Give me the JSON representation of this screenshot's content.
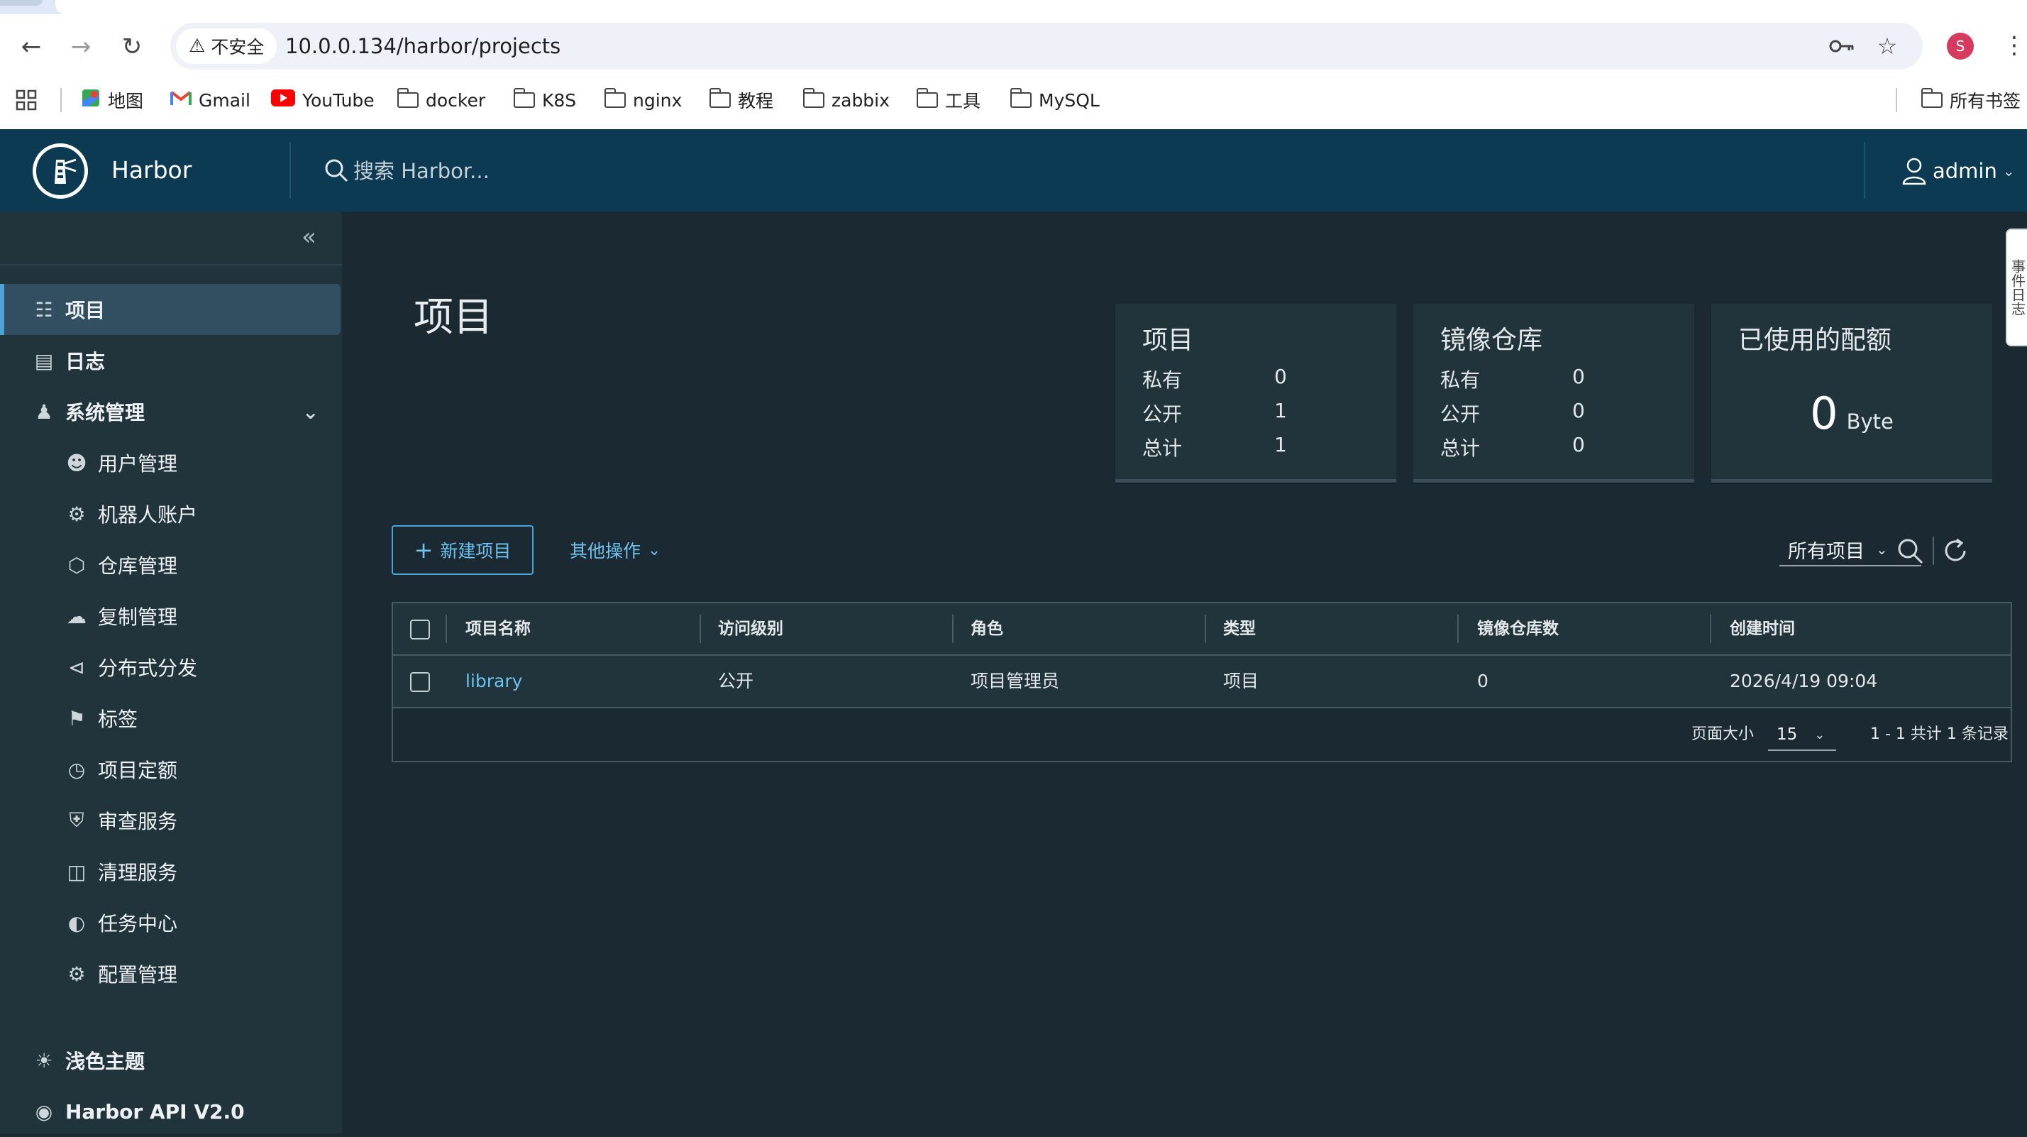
{
  "browser": {
    "security_label": "不安全",
    "url": "10.0.0.134/harbor/projects",
    "profile_initial": "S",
    "bookmarks": [
      {
        "label": "地图",
        "icon": "maps-icon"
      },
      {
        "label": "Gmail",
        "icon": "gmail-icon"
      },
      {
        "label": "YouTube",
        "icon": "youtube-icon"
      },
      {
        "label": "docker",
        "icon": "folder-icon"
      },
      {
        "label": "K8S",
        "icon": "folder-icon"
      },
      {
        "label": "nginx",
        "icon": "folder-icon"
      },
      {
        "label": "教程",
        "icon": "folder-icon"
      },
      {
        "label": "zabbix",
        "icon": "folder-icon"
      },
      {
        "label": "工具",
        "icon": "folder-icon"
      },
      {
        "label": "MySQL",
        "icon": "folder-icon"
      }
    ],
    "all_bookmarks": "所有书签"
  },
  "header": {
    "brand": "Harbor",
    "search_placeholder": "搜索 Harbor...",
    "user": "admin"
  },
  "sidebar": {
    "items": [
      {
        "label": "项目",
        "icon": "projects-icon",
        "level": "top",
        "active": true
      },
      {
        "label": "日志",
        "icon": "logs-icon",
        "level": "top"
      },
      {
        "label": "系统管理",
        "icon": "admin-icon",
        "level": "top",
        "expanded": true
      },
      {
        "label": "用户管理",
        "icon": "users-icon",
        "level": "sub"
      },
      {
        "label": "机器人账户",
        "icon": "robot-icon",
        "level": "sub"
      },
      {
        "label": "仓库管理",
        "icon": "registry-icon",
        "level": "sub"
      },
      {
        "label": "复制管理",
        "icon": "replication-icon",
        "level": "sub"
      },
      {
        "label": "分布式分发",
        "icon": "share-icon",
        "level": "sub"
      },
      {
        "label": "标签",
        "icon": "tag-icon",
        "level": "sub"
      },
      {
        "label": "项目定额",
        "icon": "quota-icon",
        "level": "sub"
      },
      {
        "label": "审查服务",
        "icon": "shield-icon",
        "level": "sub"
      },
      {
        "label": "清理服务",
        "icon": "trash-icon",
        "level": "sub"
      },
      {
        "label": "任务中心",
        "icon": "dashboard-icon",
        "level": "sub"
      },
      {
        "label": "配置管理",
        "icon": "gear-icon",
        "level": "sub"
      }
    ],
    "theme_toggle": "浅色主题",
    "api_link": "Harbor API V2.0"
  },
  "main": {
    "title": "项目",
    "cards": [
      {
        "title": "项目",
        "rows": [
          {
            "label": "私有",
            "value": "0"
          },
          {
            "label": "公开",
            "value": "1"
          },
          {
            "label": "总计",
            "value": "1"
          }
        ]
      },
      {
        "title": "镜像仓库",
        "rows": [
          {
            "label": "私有",
            "value": "0"
          },
          {
            "label": "公开",
            "value": "0"
          },
          {
            "label": "总计",
            "value": "0"
          }
        ]
      }
    ],
    "quota_card": {
      "title": "已使用的配额",
      "value": "0",
      "unit": "Byte"
    },
    "new_project_button": "新建项目",
    "more_actions": "其他操作",
    "filter_value": "所有项目",
    "table": {
      "columns": [
        "项目名称",
        "访问级别",
        "角色",
        "类型",
        "镜像仓库数",
        "创建时间"
      ],
      "rows": [
        [
          "library",
          "公开",
          "项目管理员",
          "项目",
          "0",
          "2026/4/19 09:04"
        ]
      ],
      "page_size_label": "页面大小",
      "page_size": "15",
      "page_info": "1 - 1 共计 1 条记录"
    }
  },
  "drawer_tab": "事件日志"
}
